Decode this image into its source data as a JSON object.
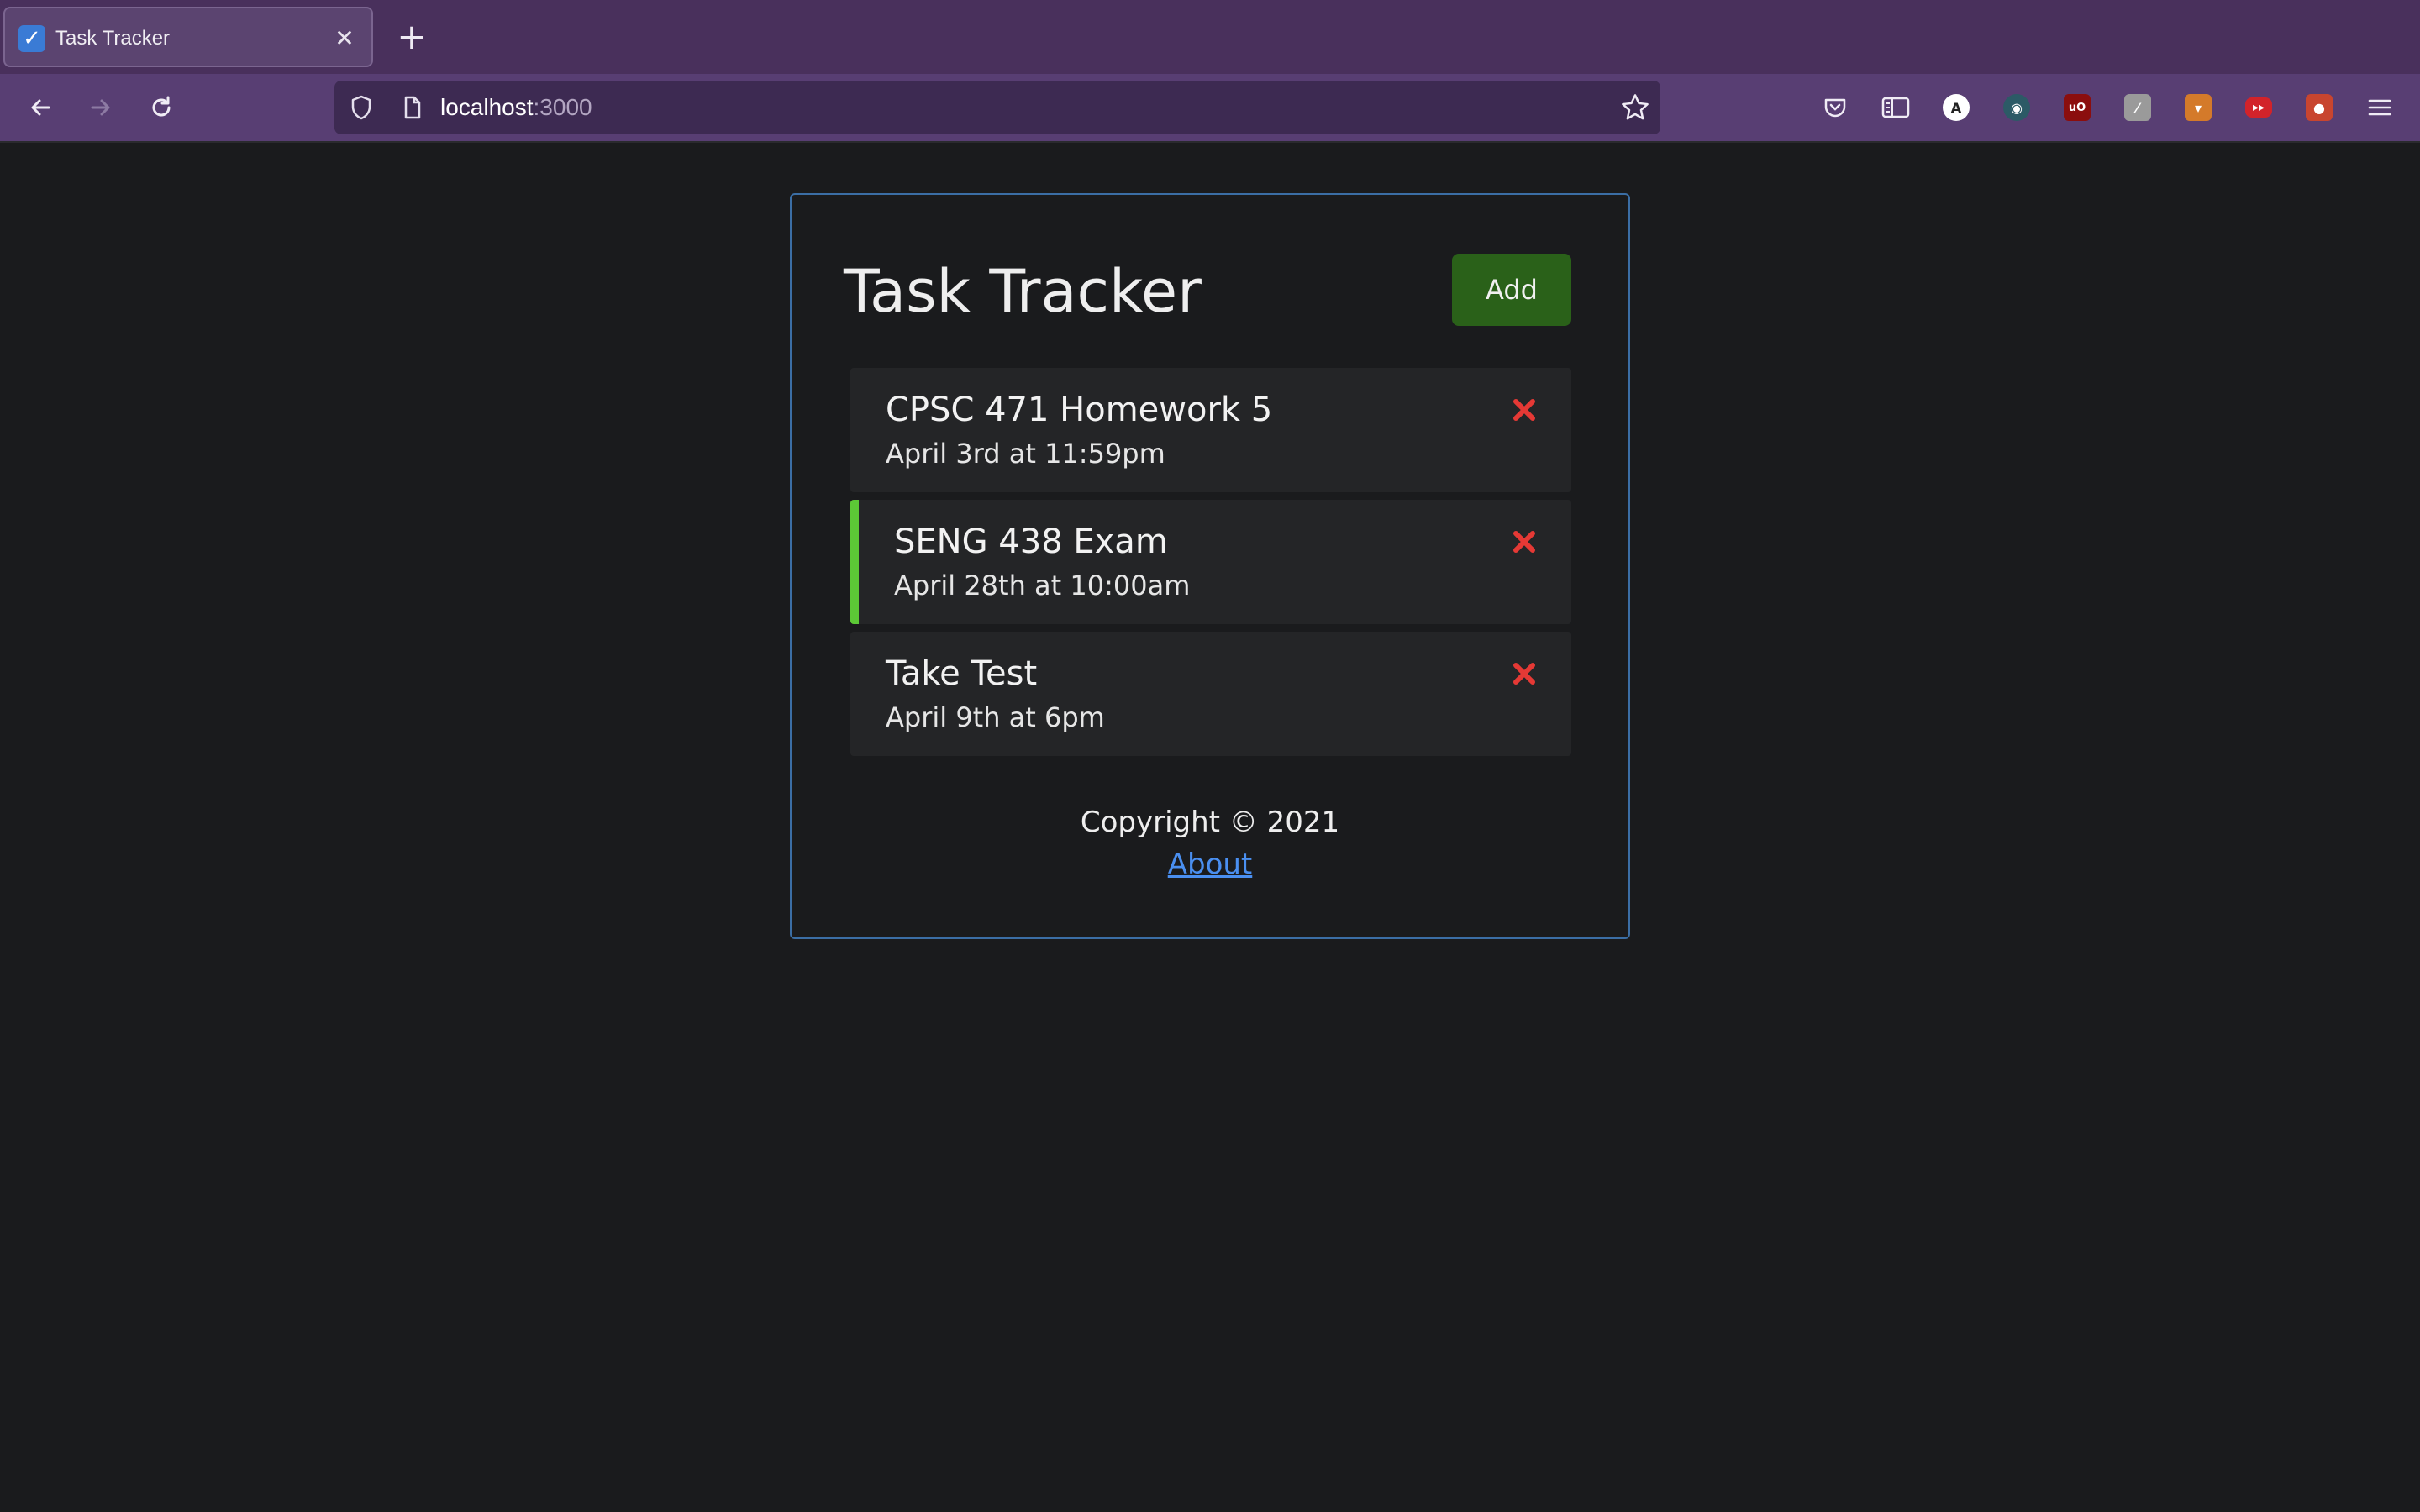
{
  "browser": {
    "tab": {
      "title": "Task Tracker",
      "favicon": "checkmark-icon"
    },
    "url": {
      "host": "localhost",
      "port": ":3000"
    }
  },
  "app": {
    "title": "Task Tracker",
    "add_label": "Add",
    "tasks": [
      {
        "text": "CPSC 471 Homework 5",
        "day": "April 3rd at 11:59pm",
        "reminder": false
      },
      {
        "text": "SENG 438 Exam",
        "day": "April 28th at 10:00am",
        "reminder": true
      },
      {
        "text": "Take Test",
        "day": "April 9th at 6pm",
        "reminder": false
      }
    ],
    "footer": {
      "copyright": "Copyright © 2021",
      "about": "About"
    }
  },
  "colors": {
    "background": "#1a1b1d",
    "add_button": "#2a6119",
    "reminder_border": "#5cc836",
    "delete_icon": "#e53935",
    "link": "#4a8ff0",
    "container_border": "#3b6ea5"
  }
}
